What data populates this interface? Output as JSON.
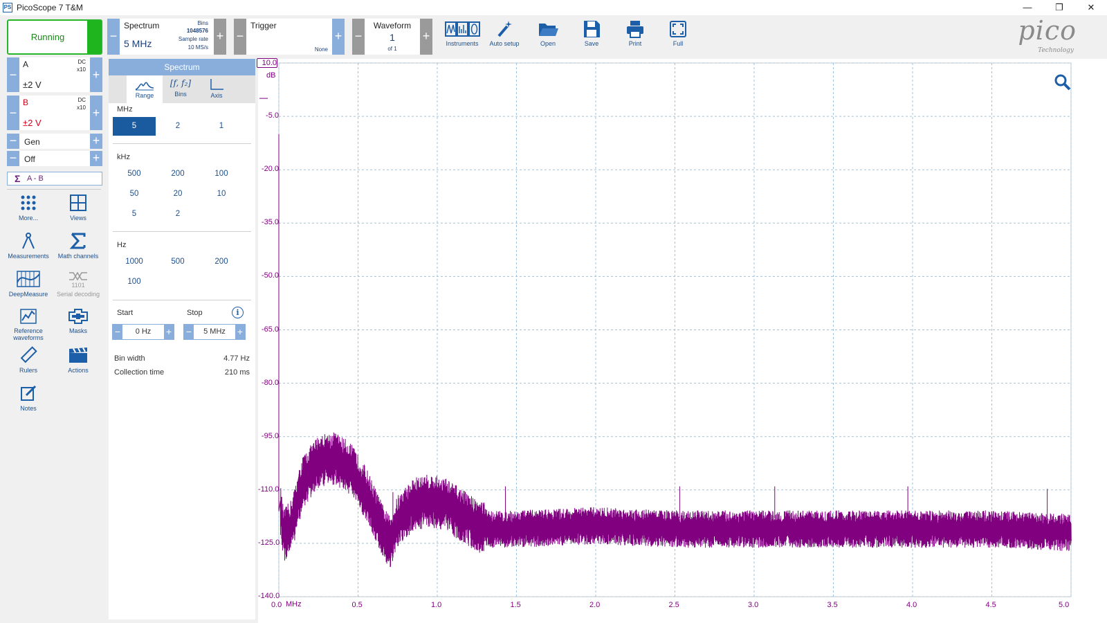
{
  "window": {
    "title": "PicoScope 7 T&M",
    "app_icon_text": "PS",
    "minimize": "—",
    "restore": "❐",
    "close": "✕"
  },
  "toolbar": {
    "run_label": "Running",
    "spectrum": {
      "label": "Spectrum",
      "value": "5 MHz",
      "bins_label": "Bins",
      "bins_value": "1048576",
      "rate_label": "Sample rate",
      "rate_value": "10 MS/s"
    },
    "trigger": {
      "label": "Trigger",
      "mode": "None"
    },
    "waveform": {
      "label": "Waveform",
      "value": "1",
      "of": "of 1"
    },
    "buttons": {
      "instruments": "Instruments",
      "auto_setup": "Auto setup",
      "open": "Open",
      "save": "Save",
      "print": "Print",
      "full": "Full"
    },
    "logo": "pico",
    "logo_sub": "Technology",
    "plus": "+",
    "minus": "−"
  },
  "channels": [
    {
      "name": "A",
      "coupling": "DC",
      "probe": "x10",
      "range": "±2 V",
      "color": "#222222"
    },
    {
      "name": "B",
      "coupling": "DC",
      "probe": "x10",
      "range": "±2 V",
      "color": "#d0021b"
    }
  ],
  "generator": {
    "label": "Gen",
    "state": "Off"
  },
  "math": {
    "label": "A - B",
    "symbol": "Σ"
  },
  "sidebar": {
    "more": "More...",
    "views": "Views",
    "measurements": "Measurements",
    "math_channels": "Math channels",
    "deepmeasure": "DeepMeasure",
    "serial_decoding": "Serial decoding",
    "serial_icon_text": "1101",
    "reference_waveforms": "Reference waveforms",
    "masks": "Masks",
    "rulers": "Rulers",
    "actions": "Actions",
    "notes": "Notes"
  },
  "panel": {
    "title": "Spectrum",
    "tabs": [
      "Range",
      "Bins",
      "Axis"
    ],
    "bins_icon_text": "[f, f₂]",
    "mhz": {
      "label": "MHz",
      "options": [
        "5",
        "2",
        "1"
      ],
      "selected": "5"
    },
    "khz": {
      "label": "kHz",
      "options": [
        "500",
        "200",
        "100",
        "50",
        "20",
        "10",
        "5",
        "2"
      ]
    },
    "hz": {
      "label": "Hz",
      "options": [
        "1000",
        "500",
        "200",
        "100"
      ]
    },
    "start": {
      "label": "Start",
      "value": "0 Hz"
    },
    "stop": {
      "label": "Stop",
      "value": "5 MHz"
    },
    "info_icon": "i",
    "bin_width": {
      "label": "Bin width",
      "value": "4.77 Hz"
    },
    "collection_time": {
      "label": "Collection time",
      "value": "210 ms"
    }
  },
  "chart_data": {
    "type": "line",
    "xlabel": "MHz",
    "ylabel": "dB",
    "xlim": [
      0,
      5
    ],
    "ylim": [
      -140,
      10
    ],
    "grid": true,
    "xticks": [
      "0.0",
      "0.5",
      "1.0",
      "1.5",
      "2.0",
      "2.5",
      "3.0",
      "3.5",
      "4.0",
      "4.5",
      "5.0"
    ],
    "yticks": [
      "10.0",
      "-5.0",
      "-20.0",
      "-35.0",
      "-50.0",
      "-65.0",
      "-80.0",
      "-95.0",
      "-110.0",
      "-125.0",
      "-140.0"
    ],
    "series": [
      {
        "color": "#800080",
        "x": [
          0,
          0.01,
          0.03,
          0.08,
          0.15,
          0.25,
          0.35,
          0.45,
          0.55,
          0.65,
          0.7,
          0.75,
          0.85,
          0.95,
          1.05,
          1.15,
          1.25,
          1.35,
          1.5,
          2.0,
          2.5,
          3.0,
          3.5,
          4.0,
          4.5,
          5.0
        ],
        "y": [
          -10,
          -116,
          -123,
          -120,
          -108,
          -102,
          -101,
          -104,
          -111,
          -121,
          -125,
          -119,
          -114,
          -113,
          -114,
          -117,
          -120,
          -121,
          -121,
          -120,
          -121,
          -121,
          -121,
          -121,
          -121,
          -122
        ]
      }
    ]
  }
}
